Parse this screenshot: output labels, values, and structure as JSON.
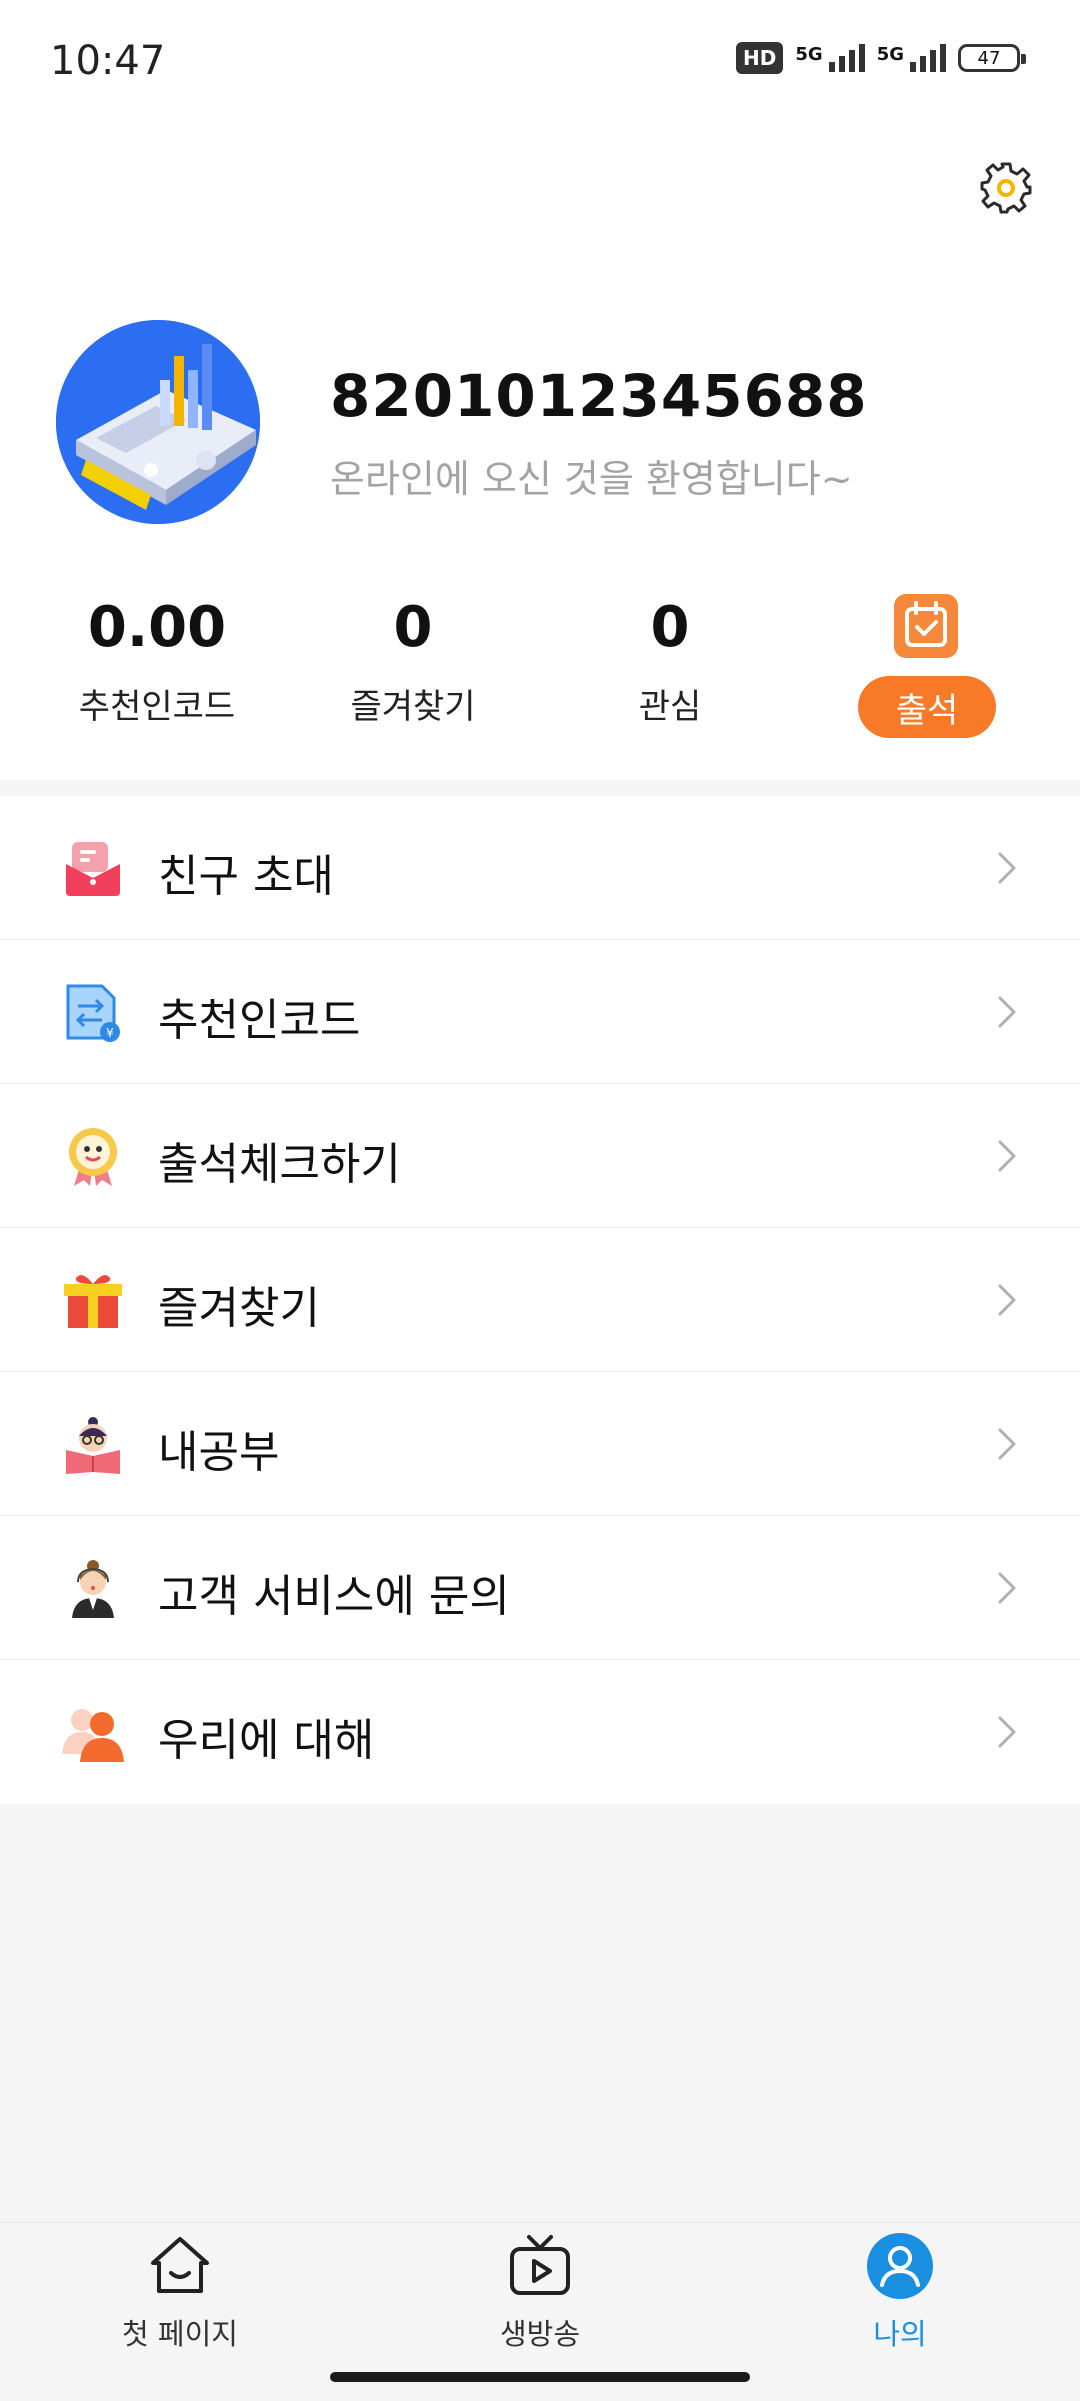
{
  "status_bar": {
    "time": "10:47",
    "hd": "HD",
    "signal1": "5G",
    "signal2": "5G",
    "battery": "47"
  },
  "profile": {
    "user_id": "8201012345688",
    "welcome": "온라인에 오신 것을 환영합니다~"
  },
  "stats": [
    {
      "value": "0.00",
      "label": "추천인코드"
    },
    {
      "value": "0",
      "label": "즐겨찾기"
    },
    {
      "value": "0",
      "label": "관심"
    }
  ],
  "checkin": {
    "label": "출석"
  },
  "menu": [
    {
      "label": "친구 초대",
      "icon": "invite-envelope-icon"
    },
    {
      "label": "추천인코드",
      "icon": "document-exchange-icon"
    },
    {
      "label": "출석체크하기",
      "icon": "medal-face-icon"
    },
    {
      "label": "즐겨찾기",
      "icon": "gift-box-icon"
    },
    {
      "label": "내공부",
      "icon": "reading-person-icon"
    },
    {
      "label": "고객 서비스에 문의",
      "icon": "customer-service-icon"
    },
    {
      "label": "우리에 대해",
      "icon": "users-icon"
    }
  ],
  "nav": [
    {
      "label": "첫 페이지",
      "icon": "home-icon"
    },
    {
      "label": "생방송",
      "icon": "tv-play-icon"
    },
    {
      "label": "나의",
      "icon": "user-icon",
      "active": true
    }
  ],
  "colors": {
    "accent": "#f87a28",
    "active_nav": "#1a8fe0",
    "muted": "#a3a3a3"
  }
}
